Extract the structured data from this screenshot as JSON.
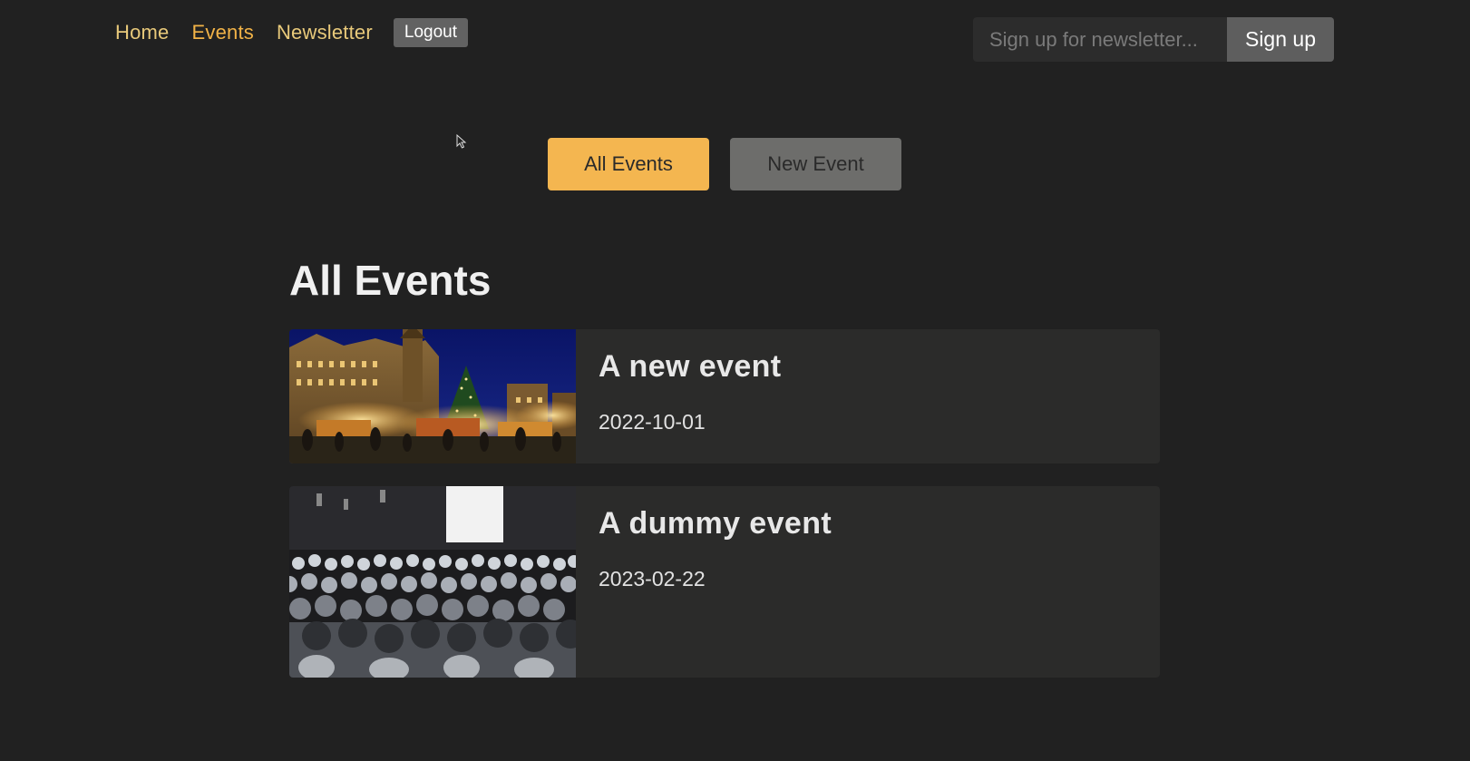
{
  "main_nav": {
    "links": [
      {
        "label": "Home"
      },
      {
        "label": "Events"
      },
      {
        "label": "Newsletter"
      }
    ],
    "logout_label": "Logout"
  },
  "newsletter": {
    "placeholder": "Sign up for newsletter...",
    "button_label": "Sign up"
  },
  "events_nav": {
    "all_events_label": "All Events",
    "new_event_label": "New Event"
  },
  "page": {
    "heading": "All Events"
  },
  "events": [
    {
      "title": "A new event",
      "date": "2022-10-01"
    },
    {
      "title": "A dummy event",
      "date": "2023-02-22"
    }
  ],
  "colors": {
    "background": "#212121",
    "accent": "#f4b650",
    "nav_link": "#e8c97a",
    "card": "#2b2b2a"
  }
}
